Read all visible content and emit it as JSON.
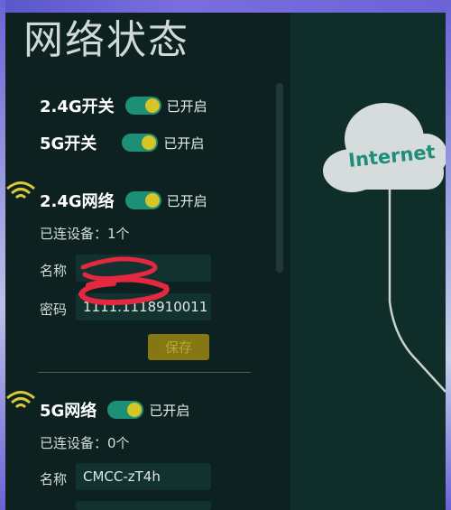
{
  "title": "网络状态",
  "switches": {
    "g24": {
      "label": "2.4G开关",
      "status": "已开启"
    },
    "g5": {
      "label": "5G开关",
      "status": "已开启"
    }
  },
  "net24": {
    "label": "2.4G网络",
    "status": "已开启",
    "devices": "已连设备：1个",
    "name_label": "名称",
    "name_value": "",
    "password_label": "密码",
    "password_value": "1111.1118910011",
    "save_label": "保存"
  },
  "net5": {
    "label": "5G网络",
    "status": "已开启",
    "devices": "已连设备：0个",
    "name_label": "名称",
    "name_value": "CMCC-zT4h"
  },
  "diagram": {
    "cloud_label": "Internet"
  },
  "colors": {
    "accent": "#1d8f76",
    "knob": "#d6c524",
    "wifi_icon": "#d9c83a",
    "scribble": "#e5283f"
  }
}
